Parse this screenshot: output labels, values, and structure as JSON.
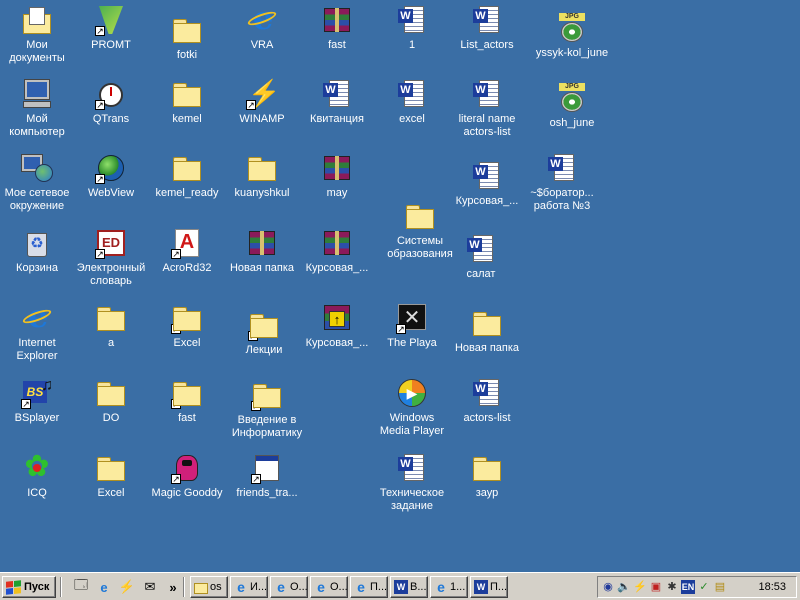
{
  "desktop": {
    "icons": [
      {
        "label": "Мои документы",
        "icon": "mydocs-icon",
        "shortcut": false
      },
      {
        "label": "PROMT",
        "icon": "promt-icon",
        "shortcut": true
      },
      {
        "label": "fotki",
        "icon": "folder-icon",
        "shortcut": false
      },
      {
        "label": "VRA",
        "icon": "ie-document-icon",
        "shortcut": false
      },
      {
        "label": "fast",
        "icon": "winrar-archive-icon",
        "shortcut": false
      },
      {
        "label": "1",
        "icon": "word-document-icon",
        "shortcut": false
      },
      {
        "label": "List_actors",
        "icon": "word-document-icon",
        "shortcut": false
      },
      {
        "label": "yssyk-kol_june",
        "icon": "jpg-image-icon",
        "shortcut": false
      },
      {
        "label": "Мой компьютер",
        "icon": "computer-icon",
        "shortcut": false
      },
      {
        "label": "QTrans",
        "icon": "stopwatch-icon",
        "shortcut": true
      },
      {
        "label": "kemel",
        "icon": "folder-icon",
        "shortcut": false
      },
      {
        "label": "WINAMP",
        "icon": "winamp-icon",
        "shortcut": true
      },
      {
        "label": "Квитанция",
        "icon": "word-document-icon",
        "shortcut": false
      },
      {
        "label": "excel",
        "icon": "word-document-icon",
        "shortcut": false
      },
      {
        "label": "literal name actors-list",
        "icon": "word-document-icon",
        "shortcut": false
      },
      {
        "label": "osh_june",
        "icon": "jpg-image-icon",
        "shortcut": false
      },
      {
        "label": "Мое сетевое окружение",
        "icon": "network-icon",
        "shortcut": false
      },
      {
        "label": "WebView",
        "icon": "globe-icon",
        "shortcut": true
      },
      {
        "label": "kemel_ready",
        "icon": "folder-icon",
        "shortcut": false
      },
      {
        "label": "kuanyshkul",
        "icon": "folder-icon",
        "shortcut": false
      },
      {
        "label": "may",
        "icon": "winrar-archive-icon",
        "shortcut": false
      },
      {
        "label": "Курсовая_...",
        "icon": "word-document-icon",
        "shortcut": false
      },
      {
        "label": "~$боратор... работа №3",
        "icon": "word-document-icon",
        "shortcut": false
      },
      {
        "label": "Корзина",
        "icon": "recycle-bin-icon",
        "shortcut": false
      },
      {
        "label": "Электронный словарь",
        "icon": "dictionary-icon",
        "shortcut": true
      },
      {
        "label": "AcroRd32",
        "icon": "acrobat-icon",
        "shortcut": true
      },
      {
        "label": "Новая папка",
        "icon": "winrar-archive-icon",
        "shortcut": false
      },
      {
        "label": "Курсовая_...",
        "icon": "winrar-archive-icon",
        "shortcut": false
      },
      {
        "label": "Системы образования",
        "icon": "folder-icon",
        "shortcut": false
      },
      {
        "label": "салат",
        "icon": "word-document-icon",
        "shortcut": false
      },
      {
        "label": "Internet Explorer",
        "icon": "internet-explorer-icon",
        "shortcut": false
      },
      {
        "label": "a",
        "icon": "folder-icon",
        "shortcut": false
      },
      {
        "label": "Excel",
        "icon": "folder-icon",
        "shortcut": true
      },
      {
        "label": "Лекции",
        "icon": "folder-icon",
        "shortcut": true
      },
      {
        "label": "Курсовая_...",
        "icon": "winrar-sfx-icon",
        "shortcut": false
      },
      {
        "label": "The Playa",
        "icon": "theplaya-icon",
        "shortcut": true
      },
      {
        "label": "Новая папка",
        "icon": "folder-icon",
        "shortcut": false
      },
      {
        "label": "BSplayer",
        "icon": "bsplayer-icon",
        "shortcut": true
      },
      {
        "label": "DO",
        "icon": "folder-icon",
        "shortcut": false
      },
      {
        "label": "fast",
        "icon": "folder-icon",
        "shortcut": true
      },
      {
        "label": "Введение в Информатику",
        "icon": "folder-icon",
        "shortcut": true
      },
      {
        "label": "Windows Media Player",
        "icon": "media-player-icon",
        "shortcut": false
      },
      {
        "label": "actors-list",
        "icon": "word-document-icon",
        "shortcut": false
      },
      {
        "label": "ICQ",
        "icon": "icq-flower-icon",
        "shortcut": false
      },
      {
        "label": "Excel",
        "icon": "folder-icon",
        "shortcut": false
      },
      {
        "label": "Magic Gooddy",
        "icon": "magic-goody-icon",
        "shortcut": true
      },
      {
        "label": "friends_tra...",
        "icon": "executable-icon",
        "shortcut": true
      },
      {
        "label": "Техническое задание",
        "icon": "word-document-icon",
        "shortcut": false
      },
      {
        "label": "заур",
        "icon": "folder-icon",
        "shortcut": false
      }
    ]
  },
  "taskbar": {
    "start_label": "Пуск",
    "quick_launch": [
      {
        "icon": "show-desktop-icon",
        "glyph": "🗔"
      },
      {
        "icon": "internet-explorer-icon",
        "glyph": "e"
      },
      {
        "icon": "winamp-icon",
        "glyph": "⚡"
      },
      {
        "icon": "outlook-icon",
        "glyph": "✉"
      }
    ],
    "overflow_label": "»",
    "tasks": [
      {
        "label": "os",
        "icon": "folder-icon"
      },
      {
        "label": "И...",
        "icon": "internet-explorer-icon"
      },
      {
        "label": "О...",
        "icon": "internet-explorer-icon"
      },
      {
        "label": "О...",
        "icon": "internet-explorer-icon"
      },
      {
        "label": "П...",
        "icon": "internet-explorer-icon"
      },
      {
        "label": "В...",
        "icon": "word-document-icon"
      },
      {
        "label": "1...",
        "icon": "internet-explorer-icon"
      },
      {
        "label": "П...",
        "icon": "word-document-icon"
      }
    ],
    "tray": {
      "icons": [
        "network-tray-icon",
        "volume-icon",
        "winamp-tray-icon",
        "office-icon",
        "bug-icon",
        "language-indicator",
        "shield-icon",
        "notes-icon"
      ],
      "language": "EN",
      "clock": "18:53"
    }
  },
  "colors": {
    "desktop_background": "#3a6ea5",
    "taskbar": "#d4d0c8"
  }
}
